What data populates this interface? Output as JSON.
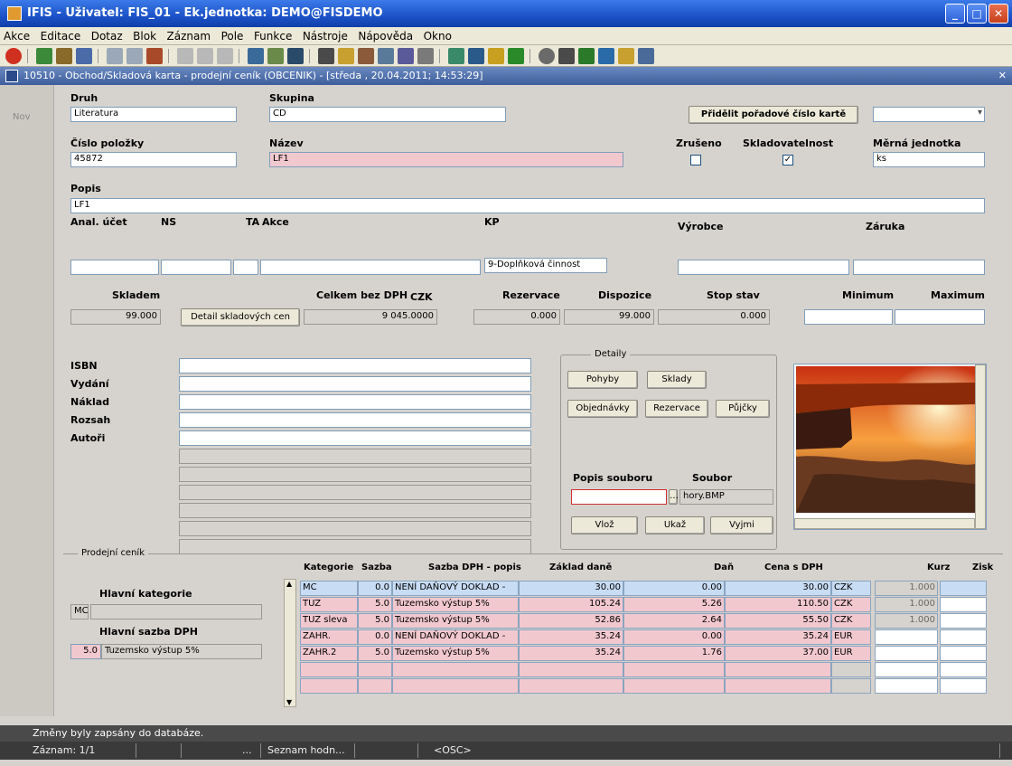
{
  "window": {
    "title": "IFIS - Uživatel: FIS_01 - Ek.jednotka: DEMO@FISDEMO"
  },
  "menu": [
    "Akce",
    "Editace",
    "Dotaz",
    "Blok",
    "Záznam",
    "Pole",
    "Funkce",
    "Nástroje",
    "Nápověda",
    "Okno"
  ],
  "form": {
    "title": "10510 - Obchod/Skladová karta - prodejní ceník (OBCENIK) - [středa , 20.04.2011; 14:53:29]",
    "mode": "Nov"
  },
  "header": {
    "druh_label": "Druh",
    "druh_value": "Literatura",
    "skupina_label": "Skupina",
    "skupina_value": "CD",
    "assign_button": "Přidělit pořadové číslo kartě",
    "cislo_label": "Číslo položky",
    "cislo_value": "45872",
    "nazev_label": "Název",
    "nazev_value": "LF1",
    "zruseno_label": "Zrušeno",
    "sklad_label": "Skladovatelnost",
    "mj_label": "Měrná jednotka",
    "mj_value": "ks",
    "popis_label": "Popis",
    "popis_value": "LF1",
    "anal_label": "Anal. účet",
    "ns_label": "NS",
    "ta_label": "TA",
    "akce_label": "Akce",
    "kp_label": "KP",
    "kp_value": "9-Doplňková činnost",
    "vyrobce_label": "Výrobce",
    "zaruka_label": "Záruka"
  },
  "stock": {
    "skladem_label": "Skladem",
    "skladem_value": "99.000",
    "detail_button": "Detail skladových cen",
    "celkem_label": "Celkem bez DPH",
    "celkem_currency": "CZK",
    "celkem_value": "9 045.0000",
    "rezervace_label": "Rezervace",
    "rezervace_value": "0.000",
    "dispozice_label": "Dispozice",
    "dispozice_value": "99.000",
    "stop_label": "Stop stav",
    "stop_value": "0.000",
    "minimum_label": "Minimum",
    "maximum_label": "Maximum"
  },
  "book": {
    "isbn": "ISBN",
    "vydani": "Vydání",
    "naklad": "Náklad",
    "rozsah": "Rozsah",
    "autori": "Autoři"
  },
  "details": {
    "title": "Detaily",
    "pohyby": "Pohyby",
    "sklady": "Sklady",
    "objednavky": "Objednávky",
    "rezervace": "Rezervace",
    "pujcky": "Půjčky",
    "popis_souboru_label": "Popis souboru",
    "soubor_label": "Soubor",
    "soubor_value": "hory.BMP",
    "vloz": "Vlož",
    "ukaz": "Ukaž",
    "vyjmi": "Vyjmi"
  },
  "pricing": {
    "section_title": "Prodejní ceník",
    "hlavni_kategorie_label": "Hlavní kategorie",
    "hlavni_kategorie_value": "MC",
    "hlavni_sazba_label": "Hlavní sazba DPH",
    "hlavni_sazba_rate": "5.0",
    "hlavni_sazba_desc": "Tuzemsko výstup 5%",
    "columns": [
      "Kategorie",
      "Sazba",
      "Sazba DPH - popis",
      "Základ daně",
      "Daň",
      "Cena s DPH",
      "Kurz",
      "Zisk"
    ],
    "rows": [
      {
        "kat": "MC",
        "sazba": "0.0",
        "popis": "NENÍ DAŇOVÝ DOKLAD -",
        "zaklad": "30.00",
        "dan": "0.00",
        "cena": "30.00",
        "mena": "CZK",
        "kurz": "1.000"
      },
      {
        "kat": "TUZ",
        "sazba": "5.0",
        "popis": "Tuzemsko výstup 5%",
        "zaklad": "105.24",
        "dan": "5.26",
        "cena": "110.50",
        "mena": "CZK",
        "kurz": "1.000"
      },
      {
        "kat": "TUZ sleva",
        "sazba": "5.0",
        "popis": "Tuzemsko výstup 5%",
        "zaklad": "52.86",
        "dan": "2.64",
        "cena": "55.50",
        "mena": "CZK",
        "kurz": "1.000"
      },
      {
        "kat": "ZAHR.",
        "sazba": "0.0",
        "popis": "NENÍ DAŇOVÝ DOKLAD -",
        "zaklad": "35.24",
        "dan": "0.00",
        "cena": "35.24",
        "mena": "EUR",
        "kurz": ""
      },
      {
        "kat": "ZAHR.2",
        "sazba": "5.0",
        "popis": "Tuzemsko výstup 5%",
        "zaklad": "35.24",
        "dan": "1.76",
        "cena": "37.00",
        "mena": "EUR",
        "kurz": ""
      }
    ]
  },
  "status": {
    "message": "Změny byly zapsány do databáze.",
    "record": "Záznam: 1/1",
    "dots": "...",
    "list": "Seznam hodn...",
    "osc": "<OSC>"
  }
}
